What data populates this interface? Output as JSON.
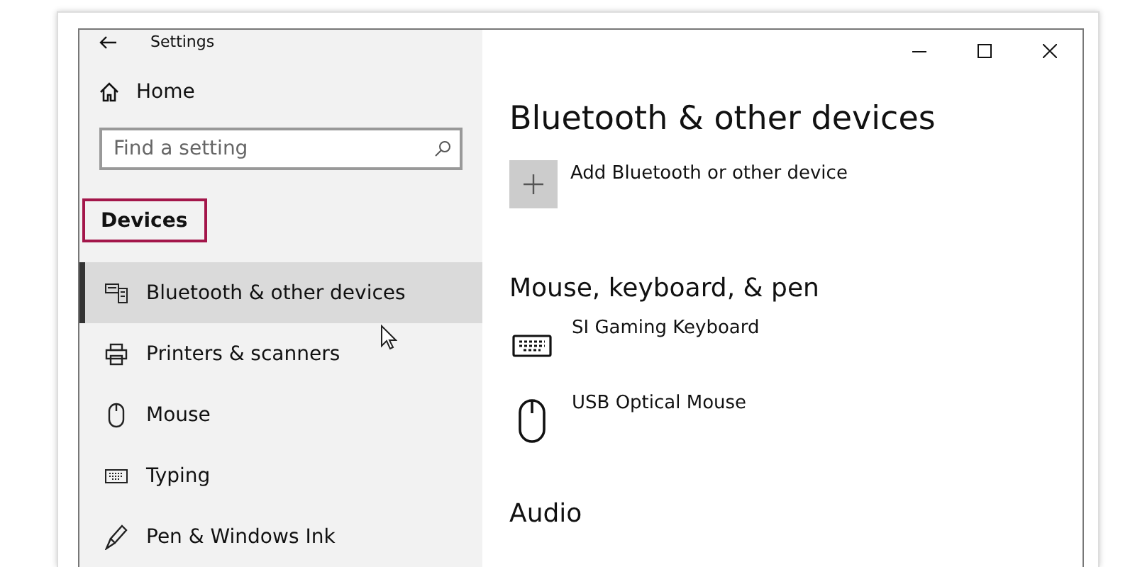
{
  "window": {
    "title": "Settings"
  },
  "sidebar": {
    "home": "Home",
    "search": {
      "placeholder": "Find a setting"
    },
    "section": {
      "label": "Devices",
      "highlighted": true
    },
    "items": [
      {
        "label": "Bluetooth & other devices",
        "kind": "bluetooth",
        "selected": true
      },
      {
        "label": "Printers & scanners",
        "kind": "printer",
        "selected": false
      },
      {
        "label": "Mouse",
        "kind": "mouse",
        "selected": false
      },
      {
        "label": "Typing",
        "kind": "keyboard",
        "selected": false
      },
      {
        "label": "Pen & Windows Ink",
        "kind": "pen",
        "selected": false
      }
    ]
  },
  "content": {
    "title": "Bluetooth & other devices",
    "add_button": "Add Bluetooth or other device",
    "sections": [
      {
        "heading": "Mouse, keyboard, & pen",
        "devices": [
          {
            "name": "SI Gaming Keyboard",
            "kind": "keyboard"
          },
          {
            "name": "USB Optical Mouse",
            "kind": "mouse"
          }
        ]
      },
      {
        "heading": "Audio"
      }
    ]
  }
}
